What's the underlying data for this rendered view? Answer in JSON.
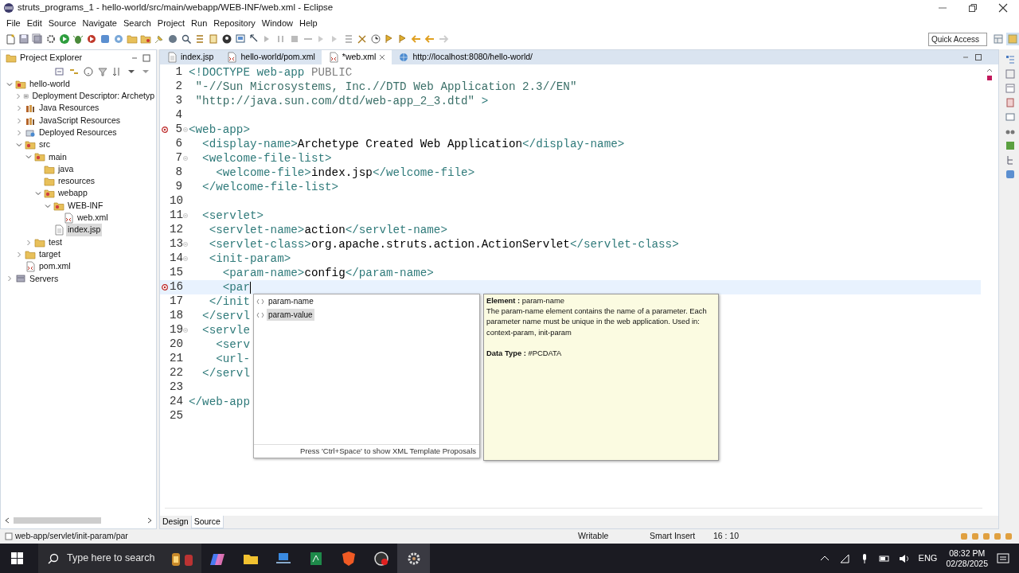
{
  "window": {
    "title": "struts_programs_1 - hello-world/src/main/webapp/WEB-INF/web.xml - Eclipse"
  },
  "menu": [
    "File",
    "Edit",
    "Source",
    "Navigate",
    "Search",
    "Project",
    "Run",
    "Repository",
    "Window",
    "Help"
  ],
  "quick_access": {
    "placeholder": "Quick Access"
  },
  "project_explorer": {
    "title": "Project Explorer",
    "tree": [
      {
        "label": "hello-world",
        "kind": "project",
        "expanded": true,
        "selected": false,
        "children": [
          {
            "label": "Deployment Descriptor: Archetyp",
            "kind": "descriptor",
            "expanded": false,
            "selected": false
          },
          {
            "label": "Java Resources",
            "kind": "library",
            "expanded": false,
            "selected": false
          },
          {
            "label": "JavaScript Resources",
            "kind": "library",
            "expanded": false,
            "selected": false
          },
          {
            "label": "Deployed Resources",
            "kind": "deployed",
            "expanded": false,
            "selected": false
          },
          {
            "label": "src",
            "kind": "srcfolder",
            "expanded": true,
            "selected": false,
            "children": [
              {
                "label": "main",
                "kind": "srcfolder",
                "expanded": true,
                "selected": false,
                "children": [
                  {
                    "label": "java",
                    "kind": "folder",
                    "selected": false
                  },
                  {
                    "label": "resources",
                    "kind": "folder",
                    "selected": false
                  },
                  {
                    "label": "webapp",
                    "kind": "srcfolder",
                    "expanded": true,
                    "selected": false,
                    "children": [
                      {
                        "label": "WEB-INF",
                        "kind": "srcfolder",
                        "expanded": true,
                        "selected": false,
                        "children": [
                          {
                            "label": "web.xml",
                            "kind": "xml",
                            "selected": false
                          }
                        ]
                      },
                      {
                        "label": "index.jsp",
                        "kind": "file",
                        "selected": true
                      }
                    ]
                  }
                ]
              },
              {
                "label": "test",
                "kind": "folder",
                "expanded": false,
                "selected": false
              }
            ]
          },
          {
            "label": "target",
            "kind": "folder",
            "expanded": false,
            "selected": false
          },
          {
            "label": "pom.xml",
            "kind": "xml",
            "selected": false
          }
        ]
      },
      {
        "label": "Servers",
        "kind": "server",
        "expanded": false,
        "selected": false
      }
    ]
  },
  "editor_tabs": [
    {
      "label": "index.jsp",
      "kind": "file",
      "selected": false
    },
    {
      "label": "hello-world/pom.xml",
      "kind": "xml",
      "selected": false
    },
    {
      "label": "*web.xml",
      "kind": "xml",
      "selected": true
    },
    {
      "label": "http://localhost:8080/hello-world/",
      "kind": "web",
      "selected": false
    }
  ],
  "lines": [
    {
      "number": "1",
      "foldable": false,
      "error": false,
      "current": false,
      "segments": [
        {
          "kind": "tag",
          "t": "<!DOCTYPE web-app"
        },
        {
          "kind": "keyword",
          "t": " PUBLIC"
        }
      ]
    },
    {
      "number": "2",
      "foldable": false,
      "error": false,
      "current": false,
      "segments": [
        {
          "kind": "string",
          "t": " \"-//Sun Microsystems, Inc.//DTD Web Application 2.3//EN\""
        }
      ]
    },
    {
      "number": "3",
      "foldable": false,
      "error": false,
      "current": false,
      "segments": [
        {
          "kind": "string",
          "t": " \"http://java.sun.com/dtd/web-app_2_3.dtd\""
        },
        {
          "kind": "tag",
          "t": " >"
        }
      ]
    },
    {
      "number": "4",
      "foldable": false,
      "error": false,
      "current": false
    },
    {
      "number": "5",
      "foldable": true,
      "error": true,
      "current": false,
      "segments": [
        {
          "kind": "tag",
          "t": "<web-app>"
        }
      ]
    },
    {
      "number": "6",
      "foldable": false,
      "error": false,
      "current": false,
      "segments": [
        {
          "kind": "tag",
          "t": "  <display-name>"
        },
        {
          "kind": "text",
          "t": "Archetype Created Web Application"
        },
        {
          "kind": "tag",
          "t": "</display-name>"
        }
      ]
    },
    {
      "number": "7",
      "foldable": true,
      "error": false,
      "current": false,
      "segments": [
        {
          "kind": "tag",
          "t": "  <welcome-file-list>"
        }
      ]
    },
    {
      "number": "8",
      "foldable": false,
      "error": false,
      "current": false,
      "segments": [
        {
          "kind": "tag",
          "t": "    <welcome-file>"
        },
        {
          "kind": "text",
          "t": "index.jsp"
        },
        {
          "kind": "tag",
          "t": "</welcome-file>"
        }
      ]
    },
    {
      "number": "9",
      "foldable": false,
      "error": false,
      "current": false,
      "segments": [
        {
          "kind": "tag",
          "t": "  </welcome-file-list>"
        }
      ]
    },
    {
      "number": "10",
      "foldable": false,
      "error": false,
      "current": false
    },
    {
      "number": "11",
      "foldable": true,
      "error": false,
      "current": false,
      "segments": [
        {
          "kind": "tag",
          "t": "  <servlet>"
        }
      ]
    },
    {
      "number": "12",
      "foldable": false,
      "error": false,
      "current": false,
      "segments": [
        {
          "kind": "tag",
          "t": "   <servlet-name>"
        },
        {
          "kind": "text",
          "t": "action"
        },
        {
          "kind": "tag",
          "t": "</servlet-name>"
        }
      ]
    },
    {
      "number": "13",
      "foldable": true,
      "error": false,
      "current": false,
      "segments": [
        {
          "kind": "tag",
          "t": "   <servlet-class>"
        },
        {
          "kind": "text",
          "t": "org.apache.struts.action.ActionServlet"
        },
        {
          "kind": "tag",
          "t": "</servlet-class>"
        }
      ]
    },
    {
      "number": "14",
      "foldable": true,
      "error": false,
      "current": false,
      "segments": [
        {
          "kind": "tag",
          "t": "   <init-param>"
        }
      ]
    },
    {
      "number": "15",
      "foldable": false,
      "error": false,
      "current": false,
      "segments": [
        {
          "kind": "tag",
          "t": "     <param-name>"
        },
        {
          "kind": "text",
          "t": "config"
        },
        {
          "kind": "tag",
          "t": "</param-name>"
        }
      ]
    },
    {
      "number": "16",
      "foldable": false,
      "error": true,
      "current": true,
      "segments": [
        {
          "kind": "tag",
          "t": "     <par"
        }
      ]
    },
    {
      "number": "17",
      "foldable": false,
      "error": false,
      "current": false,
      "segments": [
        {
          "kind": "tag",
          "t": "   </init"
        }
      ]
    },
    {
      "number": "18",
      "foldable": false,
      "error": false,
      "current": false,
      "segments": [
        {
          "kind": "tag",
          "t": "  </servl"
        }
      ]
    },
    {
      "number": "19",
      "foldable": true,
      "error": false,
      "current": false,
      "segments": [
        {
          "kind": "tag",
          "t": "  <servle"
        }
      ]
    },
    {
      "number": "20",
      "foldable": false,
      "error": false,
      "current": false,
      "segments": [
        {
          "kind": "tag",
          "t": "    <serv"
        }
      ]
    },
    {
      "number": "21",
      "foldable": false,
      "error": false,
      "current": false,
      "segments": [
        {
          "kind": "tag",
          "t": "    <url-"
        }
      ]
    },
    {
      "number": "22",
      "foldable": false,
      "error": false,
      "current": false,
      "segments": [
        {
          "kind": "tag",
          "t": "  </servl"
        }
      ]
    },
    {
      "number": "23",
      "foldable": false,
      "error": false,
      "current": false
    },
    {
      "number": "24",
      "foldable": false,
      "error": false,
      "current": false,
      "segments": [
        {
          "kind": "tag",
          "t": "</web-app"
        }
      ]
    },
    {
      "number": "25",
      "foldable": false,
      "error": false,
      "current": false
    }
  ],
  "content_assist": {
    "proposals": [
      {
        "label": "param-name",
        "selected": false
      },
      {
        "label": "param-value",
        "selected": true
      }
    ],
    "footer": "Press 'Ctrl+Space' to show XML Template Proposals",
    "info": {
      "element": "**Element :** param-name",
      "description": "The param-name element contains the name of a parameter. Each parameter name must be unique in the web application. Used in: context-param, init-param",
      "data_type": "**Data Type :** #PCDATA"
    }
  },
  "editor_mode_tabs": [
    {
      "label": "Design",
      "selected": false
    },
    {
      "label": "Source",
      "selected": true
    }
  ],
  "status_bar": {
    "path": "web-app/servlet/init-param/par",
    "mode": "Writable",
    "insert": "Smart Insert",
    "position": "16 : 10"
  },
  "taskbar": {
    "search": {
      "placeholder": "Type here to search"
    },
    "language": "ENG",
    "time": "08:32 PM",
    "date": "02/28/2025"
  }
}
